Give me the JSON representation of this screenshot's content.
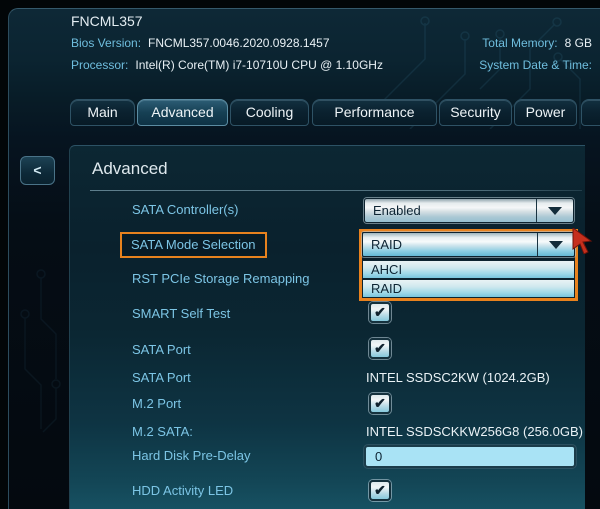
{
  "header": {
    "title": "FNCML357",
    "bios_version_label": "Bios Version:",
    "bios_version": "FNCML357.0046.2020.0928.1457",
    "processor_label": "Processor:",
    "processor": "Intel(R) Core(TM) i7-10710U CPU @ 1.10GHz",
    "total_memory_label": "Total Memory:",
    "total_memory": "8 GB",
    "datetime_label": "System Date & Time:"
  },
  "tabs": [
    {
      "label": "Main",
      "active": false
    },
    {
      "label": "Advanced",
      "active": true
    },
    {
      "label": "Cooling",
      "active": false
    },
    {
      "label": "Performance",
      "active": false
    },
    {
      "label": "Security",
      "active": false
    },
    {
      "label": "Power",
      "active": false
    }
  ],
  "back_button": "<",
  "panel": {
    "heading": "Advanced"
  },
  "rows": [
    {
      "label": "SATA Controller(s)",
      "control": "dropdown",
      "value": "Enabled"
    },
    {
      "label": "SATA Mode Selection",
      "control": "dropdown-open",
      "value": "RAID",
      "options": [
        "AHCI",
        "RAID"
      ],
      "highlighted": true
    },
    {
      "label": "RST PCIe Storage Remapping",
      "control": "none"
    },
    {
      "label": "SMART Self Test",
      "control": "checkbox",
      "checked": true
    },
    {
      "label": "SATA Port",
      "control": "checkbox",
      "checked": true
    },
    {
      "label": "SATA Port",
      "control": "text",
      "value": "INTEL SSDSC2KW (1024.2GB)"
    },
    {
      "label": "M.2 Port",
      "control": "checkbox",
      "checked": true
    },
    {
      "label": "M.2 SATA:",
      "control": "text",
      "value": "INTEL SSDSCKKW256G8 (256.0GB)"
    },
    {
      "label": "Hard Disk Pre-Delay",
      "control": "input",
      "value": "0"
    },
    {
      "label": "HDD Activity LED",
      "control": "checkbox",
      "checked": true
    }
  ],
  "icons": {
    "checkmark": "✔",
    "dropdown_arrow": "css-triangle-down",
    "cursor": "red-arrow-pointer"
  },
  "colors": {
    "highlight_orange": "#e8821e",
    "label_blue": "#7cc5e5",
    "cursor_red": "#c62f1d",
    "input_cyan": "#a9e3f5"
  }
}
